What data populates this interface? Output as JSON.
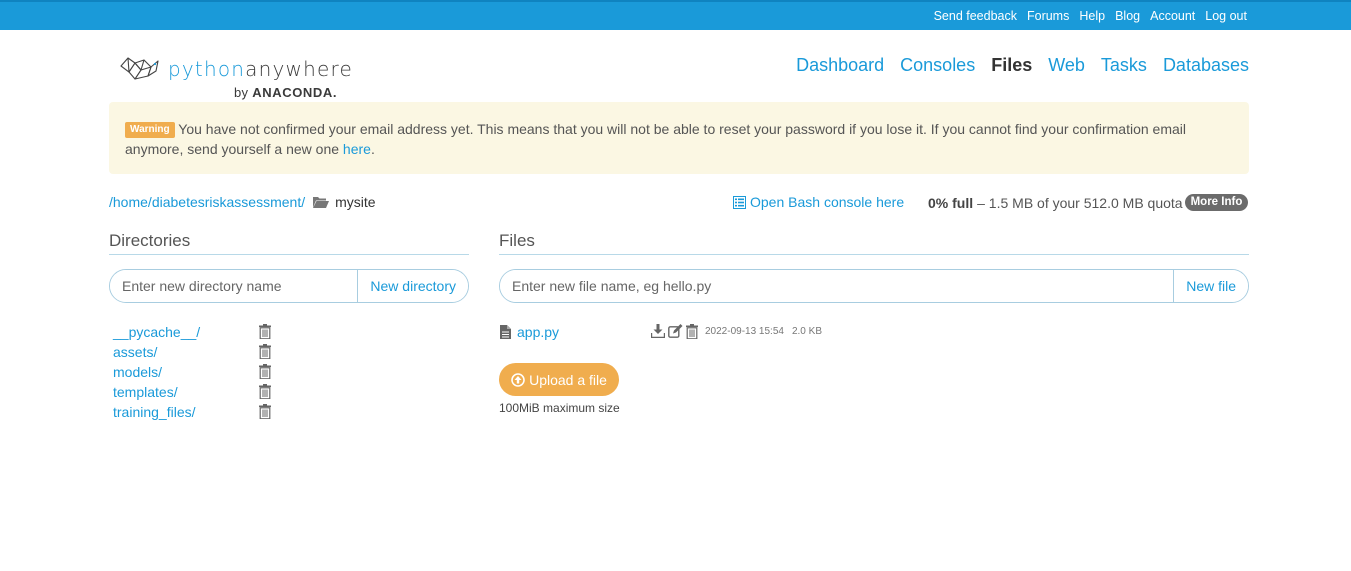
{
  "topbar": {
    "links": [
      "Send feedback",
      "Forums",
      "Help",
      "Blog",
      "Account",
      "Log out"
    ]
  },
  "logo": {
    "python": "python",
    "anywhere": "anywhere",
    "by": "by",
    "brand": "ANACONDA."
  },
  "nav": {
    "items": [
      "Dashboard",
      "Consoles",
      "Files",
      "Web",
      "Tasks",
      "Databases"
    ],
    "active": "Files"
  },
  "warning": {
    "badge": "Warning",
    "text": "You have not confirmed your email address yet. This means that you will not be able to reset your password if you lose it. If you cannot find your confirmation email anymore, send yourself a new one",
    "link": "here",
    "end": "."
  },
  "breadcrumb": {
    "root": "/home",
    "sep1": "/",
    "user": "diabetesriskassessment",
    "sep2": "/",
    "current": "mysite"
  },
  "bash": {
    "label": "Open Bash console here"
  },
  "quota": {
    "percent": "0% full",
    "rest": "– 1.5 MB of your 512.0 MB quota",
    "more": "More Info"
  },
  "directories": {
    "title": "Directories",
    "placeholder": "Enter new directory name",
    "button": "New directory",
    "items": [
      "__pycache__/",
      "assets/",
      "models/",
      "templates/",
      "training_files/"
    ]
  },
  "files": {
    "title": "Files",
    "placeholder": "Enter new file name, eg hello.py",
    "button": "New file",
    "items": [
      {
        "name": "app.py",
        "modified": "2022-09-13 15:54",
        "size": "2.0 KB"
      }
    ],
    "upload": "Upload a file",
    "upload_note": "100MiB maximum size"
  },
  "colors": {
    "accent": "#1a9ad9",
    "topbar": "#1a9ad9",
    "warning_bg": "#fbf7e3",
    "upload": "#f0ad4e"
  }
}
